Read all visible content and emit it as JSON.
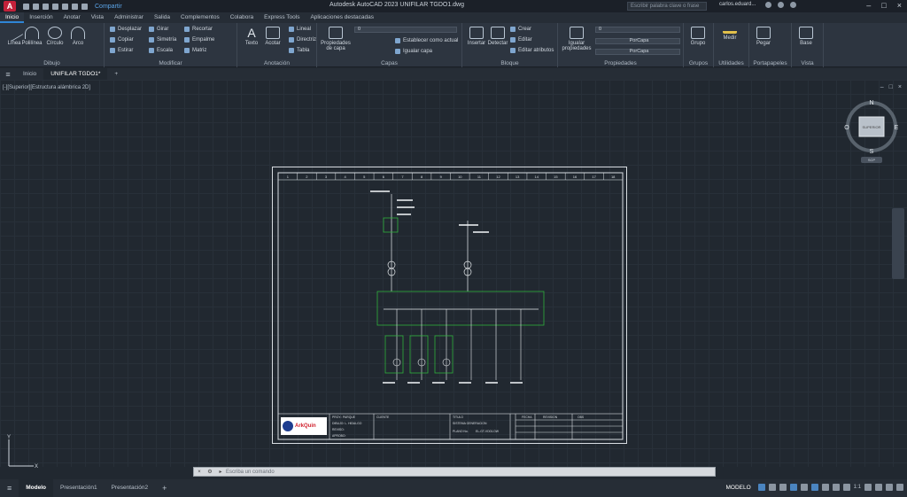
{
  "titlebar": {
    "app_letter": "A",
    "share_label": "Compartir",
    "title": "Autodesk AutoCAD 2023   UNIFILAR TGDO1.dwg",
    "search_placeholder": "Escribir palabra clave o frase",
    "user": "carlos.eduard..."
  },
  "menu_tabs": [
    "Inicio",
    "Inserción",
    "Anotar",
    "Vista",
    "Administrar",
    "Salida",
    "Complementos",
    "Colabora",
    "Express Tools",
    "Aplicaciones destacadas"
  ],
  "ribbon": {
    "dibujo": {
      "label": "Dibujo",
      "linea": "Línea",
      "polilinea": "Polilínea",
      "circulo": "Círculo",
      "arco": "Arco"
    },
    "modificar": {
      "label": "Modificar",
      "desplazar": "Desplazar",
      "copiar": "Copiar",
      "estirar": "Estirar",
      "girar": "Girar",
      "simetria": "Simetría",
      "escala": "Escala",
      "recortar": "Recortar",
      "empalme": "Empalme",
      "matriz": "Matriz"
    },
    "anotacion": {
      "label": "Anotación",
      "texto": "Texto",
      "acotar": "Acotar",
      "lineal": "Lineal",
      "directriz": "Directriz",
      "tabla": "Tabla"
    },
    "capas": {
      "label": "Capas",
      "propiedades": "Propiedades de capa",
      "capa_actual": "0",
      "establecer": "Establecer como actual",
      "igualar": "Igualar capa"
    },
    "bloque": {
      "label": "Bloque",
      "insertar": "Insertar",
      "detectar": "Detectar",
      "crear": "Crear",
      "editar": "Editar",
      "editar_atributos": "Editar atributos"
    },
    "propiedades": {
      "label": "Propiedades",
      "igualar": "Igualar propiedades",
      "color": "0",
      "linetype": "PorCapa",
      "lineweight": "PorCapa"
    },
    "grupos": {
      "label": "Grupos",
      "grupo": "Grupo"
    },
    "utilidades": {
      "label": "Utilidades",
      "medir": "Medir"
    },
    "portapapeles": {
      "label": "Portapapeles",
      "pegar": "Pegar"
    },
    "vista": {
      "label": "Vista",
      "base": "Base"
    }
  },
  "doc_tabs": {
    "inicio": "Inicio",
    "file": "UNIFILAR TGDO1*"
  },
  "viewport": {
    "label": "[-][Superior][Estructura alámbrica 2D]"
  },
  "viewcube": {
    "n": "N",
    "s": "S",
    "e": "E",
    "o": "O",
    "face": "SUPERIOR",
    "wcs": "SCP"
  },
  "command": {
    "placeholder": "Escriba un comando"
  },
  "layout_tabs": [
    "Modelo",
    "Presentación1",
    "Presentación2"
  ],
  "status": {
    "modelo": "MODELO",
    "scale": "1:1"
  },
  "drawing": {
    "column_numbers": [
      "1",
      "2",
      "3",
      "4",
      "5",
      "6",
      "7",
      "8",
      "9",
      "10",
      "11",
      "12",
      "13",
      "14",
      "15",
      "16",
      "17",
      "18"
    ],
    "title_block": {
      "logo_text": "ArkQuin",
      "col1": [
        "PROY.: PARQUE",
        "DIBUJO: L. HIDALGO",
        "REVISO:",
        "APROBO:"
      ],
      "col2_head": "CLIENTE",
      "title_head": "TITULO",
      "title": "SISTEMA GENERACION",
      "plano_label": "PLANO No.",
      "plano": "EL-GT-VD01.DW",
      "fecha": "FECHA",
      "revision": "REVISION",
      "obs": "OBS"
    }
  }
}
